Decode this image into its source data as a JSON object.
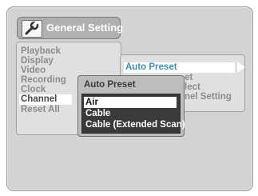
{
  "window": {
    "title": "General Setting"
  },
  "menu": {
    "items": [
      {
        "label": "Playback"
      },
      {
        "label": "Display"
      },
      {
        "label": "Video"
      },
      {
        "label": "Recording"
      },
      {
        "label": "Clock"
      },
      {
        "label": "Channel",
        "selected": true
      },
      {
        "label": "Reset All"
      }
    ]
  },
  "submenu": {
    "items": [
      {
        "label": "Auto Preset",
        "selected": true
      },
      {
        "label": "et"
      },
      {
        "label": "lect"
      },
      {
        "label": "nel Setting"
      }
    ]
  },
  "popup": {
    "title": "Auto Preset",
    "options": [
      {
        "label": "Air",
        "selected": true
      },
      {
        "label": "Cable"
      },
      {
        "label": "Cable (Extended Scan)"
      }
    ]
  },
  "icons": {
    "title": "wrench-icon",
    "submenu_arrow": "arrow-right-icon"
  }
}
